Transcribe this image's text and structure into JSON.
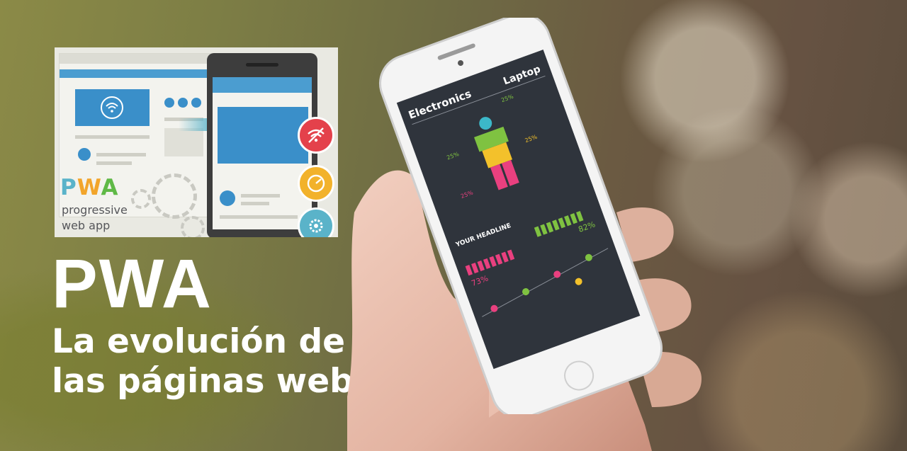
{
  "inset": {
    "logo_letters": [
      {
        "ch": "P",
        "color": "#5ab3c9"
      },
      {
        "ch": "W",
        "color": "#f2a52b"
      },
      {
        "ch": "A",
        "color": "#5fb946"
      }
    ],
    "subtitle_line1": "progressive",
    "subtitle_line2": "web app",
    "badge_icons": [
      "no-wifi-icon",
      "speedometer-icon",
      "gear-icon"
    ]
  },
  "headline": {
    "title": "PWA",
    "line1": "La evolución de",
    "line2": "las páginas web"
  },
  "phone_screen": {
    "header_left": "Electronics",
    "header_right": "Laptop",
    "section_headline": "YOUR HEADLINE",
    "stats": [
      "25%",
      "25%",
      "25%",
      "25%"
    ],
    "percent_left": "73%",
    "percent_right": "82%"
  },
  "colors": {
    "accent_blue": "#3a8fc9",
    "icon_red": "#e4414b",
    "icon_yellow": "#f2b22b",
    "icon_teal": "#5ab3c9",
    "screen_bg": "#2f343c",
    "figure_green": "#7fc241",
    "figure_pink": "#e9407f"
  }
}
